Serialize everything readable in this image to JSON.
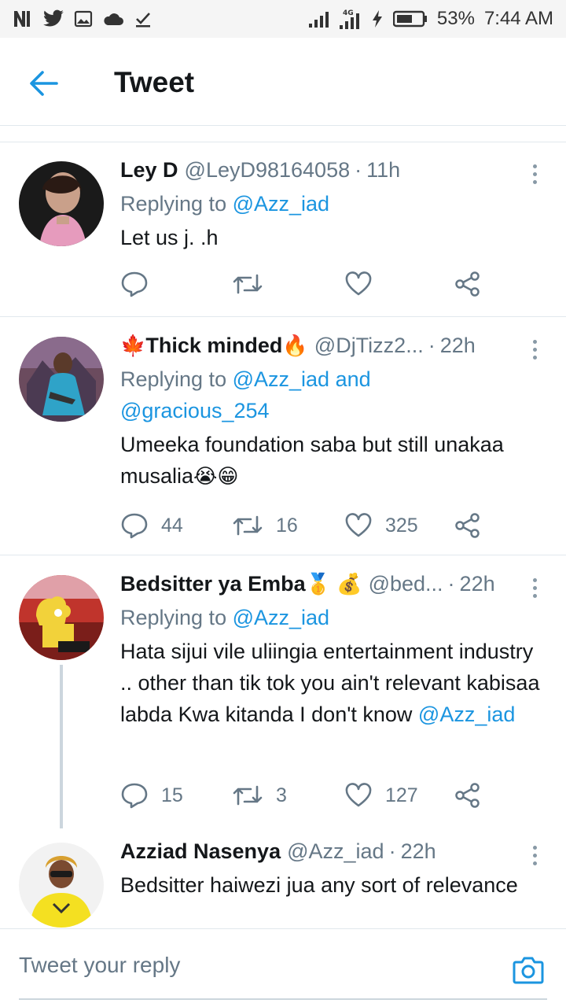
{
  "status_bar": {
    "battery": "53%",
    "time": "7:44 AM",
    "network": "4G"
  },
  "header": {
    "title": "Tweet",
    "back_icon": "arrow-left-icon"
  },
  "tweets": [
    {
      "name": "Ley D",
      "handle": "@LeyD98164058",
      "time": "11h",
      "replying_prefix": "Replying to ",
      "replying_to": "@Azz_iad",
      "text": "Let us j. .h",
      "replies": "",
      "retweets": "",
      "likes": ""
    },
    {
      "name_emoji_pre": "🍁",
      "name": "Thick minded",
      "name_emoji_post": "🔥",
      "handle": "@DjTizz2...",
      "time": "22h",
      "replying_prefix": "Replying to ",
      "replying_to": "@Azz_iad",
      "replying_and": " and",
      "replying_to_2": "@gracious_254",
      "text": "Umeeka foundation saba but still unakaa musalia",
      "text_emoji": "😭😁",
      "replies": "44",
      "retweets": "16",
      "likes": "325"
    },
    {
      "name": "Bedsitter ya Emba",
      "name_emoji_post": "🥇 💰",
      "handle": "@bed...",
      "time": "22h",
      "replying_prefix": "Replying to ",
      "replying_to": "@Azz_iad",
      "text": "Hata sijui vile  uliingia entertainment industry .. other than tik tok you ain't relevant kabisaa labda Kwa kitanda I don't know ",
      "text_mention": "@Azz_iad",
      "replies": "15",
      "retweets": "3",
      "likes": "127"
    },
    {
      "name": "Azziad Nasenya",
      "handle": "@Azz_iad",
      "time": "22h",
      "text": "Bedsitter haiwezi jua any sort of relevance"
    }
  ],
  "composer": {
    "placeholder": "Tweet your reply",
    "camera_icon": "camera-icon"
  },
  "colors": {
    "accent": "#1b95e0",
    "muted": "#657786",
    "divider": "#e1e8ed"
  }
}
